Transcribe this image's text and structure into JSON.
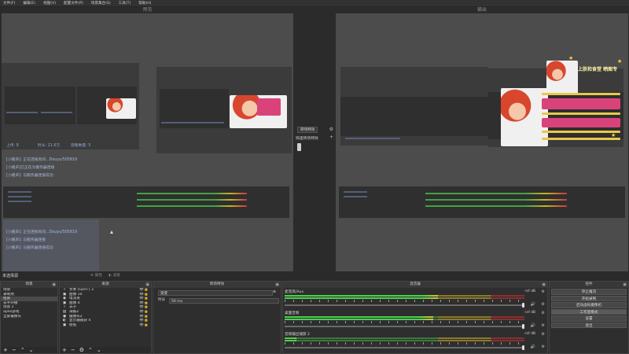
{
  "menu": [
    "文件(F)",
    "编辑(E)",
    "视图(V)",
    "配置文件(P)",
    "场景集合(S)",
    "工具(T)",
    "帮助(H)"
  ],
  "canvas": {
    "preview_title": "预览",
    "program_title": "输出"
  },
  "preview_overlay": {
    "stats": [
      "上传: 8",
      "时长: 21.6万",
      "观看数量: 5"
    ],
    "logs": [
      "[小路声]: 正在连接房间...Douyu/505819",
      "[小路声]已正在为服务器连接",
      "[小路声]: 与服务器连接成功"
    ],
    "logs2": [
      "[小路声]: 正在连接房间...Douyu/505819",
      "[小路声]: 与服务器连接",
      "[小路声]: 与服务器连接成功"
    ]
  },
  "program_overlay": {
    "title": "上肤和食堂 晒图专"
  },
  "transition_center": {
    "transition_btn": "转场特效",
    "quick_label": "快速转场特效"
  },
  "status": {
    "text": "未选择源",
    "props_btn": "属性",
    "filters_btn": "滤镜"
  },
  "scenes": {
    "title": "场景",
    "items": [
      "场景",
      "录制用",
      "抠屏",
      "去字开播",
      "场景 2",
      "apex游戏",
      "全屏摄像头"
    ],
    "selected": 2
  },
  "sources": {
    "title": "来源",
    "items": [
      {
        "icon": "T",
        "label": "文本 (GDI+) 3"
      },
      {
        "icon": "▣",
        "label": "图像 10"
      },
      {
        "icon": "◉",
        "label": "电流哥"
      },
      {
        "icon": "▣",
        "label": "图像 4"
      },
      {
        "icon": "T",
        "label": "去子"
      },
      {
        "icon": "▤",
        "label": "海报2"
      },
      {
        "icon": "▣",
        "label": "摄像头2"
      },
      {
        "icon": "◐",
        "label": "显示器捕获 4"
      },
      {
        "icon": "▣",
        "label": "壁纸"
      }
    ]
  },
  "transitions": {
    "title": "转场特效",
    "selected": "渐变",
    "duration_label": "时长",
    "duration_value": "50 ms"
  },
  "mixer": {
    "title": "混音器",
    "channels": [
      {
        "name": "麦克风/Aux",
        "db": "-inf dB",
        "level": 0.64
      },
      {
        "name": "桌面音频",
        "db": "-inf dB",
        "level": 0.62
      },
      {
        "name": "音频输出捕获 2",
        "db": "-inf dB",
        "level": 0.05
      }
    ]
  },
  "controls": {
    "title": "控件",
    "buttons": [
      "停止推流",
      "开始录制",
      "启动虚拟摄像机",
      "工作室模式",
      "设置",
      "退出"
    ],
    "active_index": 3
  },
  "colors": {
    "accent_green": "#4bd04b",
    "meter_yellow": "#d6c33a",
    "meter_red": "#c63a3a",
    "overlay_pink": "#d9437a"
  }
}
